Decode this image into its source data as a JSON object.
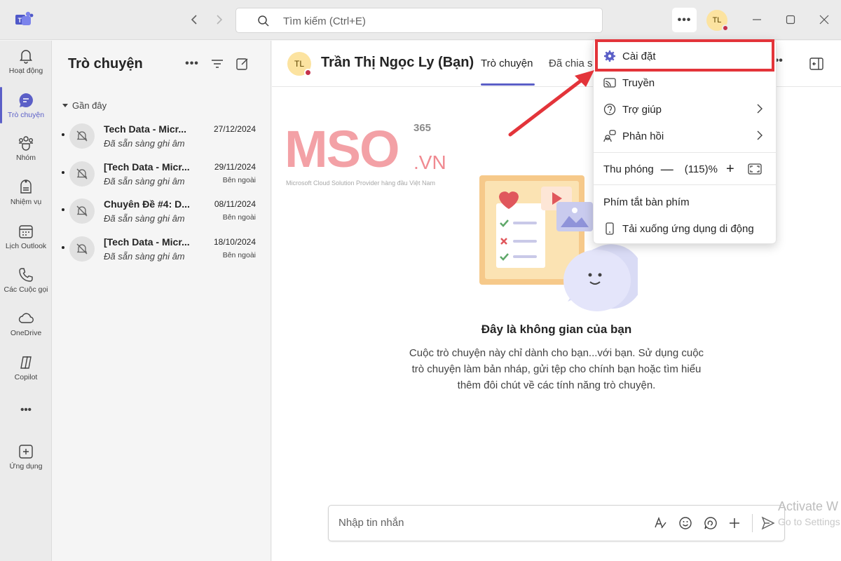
{
  "titlebar": {
    "search_placeholder": "Tìm kiếm (Ctrl+E)",
    "more_label": "•••",
    "avatar_initials": "TL"
  },
  "rail": {
    "items": [
      {
        "label": "Hoạt động",
        "icon": "bell-icon"
      },
      {
        "label": "Trò chuyện",
        "icon": "chat-icon"
      },
      {
        "label": "Nhóm",
        "icon": "teams-icon"
      },
      {
        "label": "Nhiệm vụ",
        "icon": "tasks-icon"
      },
      {
        "label": "Lịch Outlook",
        "icon": "calendar-icon"
      },
      {
        "label": "Các Cuộc gọi",
        "icon": "phone-icon"
      },
      {
        "label": "OneDrive",
        "icon": "cloud-icon"
      },
      {
        "label": "Copilot",
        "icon": "copilot-icon"
      },
      {
        "label": "•••",
        "icon": "more-icon"
      },
      {
        "label": "Ứng dụng",
        "icon": "apps-icon"
      }
    ]
  },
  "chatlist": {
    "title": "Trò chuyện",
    "section": "Gần đây",
    "chats": [
      {
        "name": "Tech Data - Micr...",
        "date": "27/12/2024",
        "preview": "Đã sẵn sàng ghi âm",
        "tag": ""
      },
      {
        "name": "[Tech Data - Micr...",
        "date": "29/11/2024",
        "preview": "Đã sẵn sàng ghi âm",
        "tag": "Bên ngoài"
      },
      {
        "name": "Chuyên Đề #4: D...",
        "date": "08/11/2024",
        "preview": "Đã sẵn sàng ghi âm",
        "tag": "Bên ngoài"
      },
      {
        "name": "[Tech Data - Micr...",
        "date": "18/10/2024",
        "preview": "Đã sẵn sàng ghi âm",
        "tag": "Bên ngoài"
      }
    ]
  },
  "main": {
    "avatar_initials": "TL",
    "name": "Trần Thị Ngọc Ly (Bạn)",
    "tabs": [
      "Trò chuyện",
      "Đã chia sẻ"
    ],
    "empty_title": "Đây là không gian của bạn",
    "empty_desc": "Cuộc trò chuyện này chỉ dành cho bạn...với bạn. Sử dụng cuộc trò chuyện làm bản nháp, gửi tệp cho chính bạn hoặc tìm hiểu thêm đôi chút về các tính năng trò chuyện.",
    "composer_placeholder": "Nhập tin nhắn"
  },
  "watermark": {
    "letters": "MSO",
    "suffix": ".VN",
    "superscript": "365",
    "tagline": "Microsoft Cloud Solution Provider hàng đầu Việt Nam"
  },
  "dropdown": {
    "settings": "Cài đặt",
    "cast": "Truyền",
    "help": "Trợ giúp",
    "feedback": "Phản hồi",
    "zoom_label": "Thu phóng",
    "zoom_minus": "—",
    "zoom_value": "(115)%",
    "zoom_plus": "+",
    "shortcuts": "Phím tắt bàn phím",
    "download": "Tải xuống ứng dụng di động"
  },
  "system": {
    "activate_title": "Activate W",
    "activate_sub": "Go to Settings"
  },
  "colors": {
    "accent": "#5b5fc7",
    "highlight": "#e3343a",
    "status_busy": "#c4314b"
  }
}
